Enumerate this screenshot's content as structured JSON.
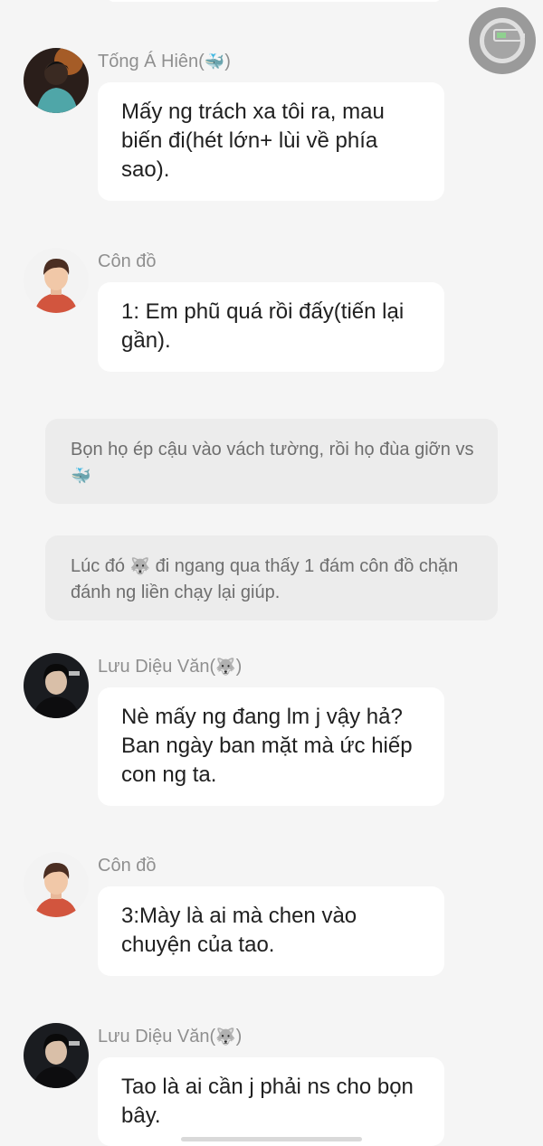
{
  "messages": [
    {
      "sender": "Tống Á Hiên",
      "sender_emoji": "🐳",
      "text": "Mấy ng trách xa tôi ra, mau biến đi(hét lớn+ lùi về phía sao)."
    },
    {
      "sender": "Côn đồ",
      "text": "1: Em phũ quá rồi đấy(tiến lại gần)."
    },
    {
      "sender": "Lưu Diệu Văn",
      "sender_emoji": "🐺",
      "text": "Nè mấy ng đang lm j vậy hả? Ban ngày ban mặt mà ức hiếp con ng ta."
    },
    {
      "sender": "Côn đồ",
      "text": "3:Mày là ai mà chen vào chuyện của tao."
    },
    {
      "sender": "Lưu Diệu Văn",
      "sender_emoji": "🐺",
      "text": "Tao là ai cần j phải ns cho bọn bây."
    }
  ],
  "narrations": [
    {
      "text_before": "Bọn họ ép cậu vào vách tường, rồi họ đùa giỡn vs",
      "emoji": "🐳",
      "text_after": ""
    },
    {
      "text_before": "Lúc đó ",
      "emoji": "🐺",
      "text_after": " đi ngang qua thấy 1 đám côn đồ chặn đánh ng liền chạy lại giúp."
    }
  ],
  "icons": {
    "floating_assistive_button": "assistive-touch-icon",
    "battery": "battery-charging-icon"
  }
}
